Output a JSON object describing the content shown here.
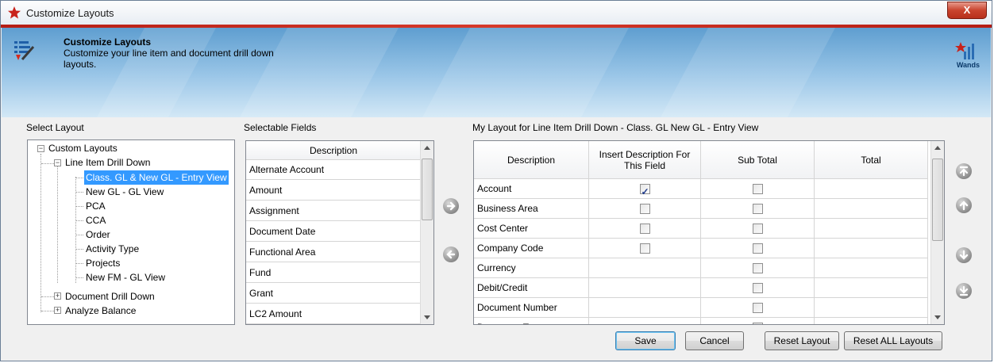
{
  "window": {
    "title": "Customize Layouts",
    "close_label": "X"
  },
  "banner": {
    "title": "Customize Layouts",
    "description": "Customize your line item and document drill down layouts.",
    "brand": "Wands"
  },
  "select_layout": {
    "label": "Select Layout",
    "tree": {
      "root": "Custom Layouts",
      "line_item": "Line Item Drill Down",
      "children": [
        "Class. GL & New GL - Entry View",
        "New GL - GL View",
        "PCA",
        "CCA",
        "Order",
        "Activity Type",
        "Projects",
        "New FM - GL View"
      ],
      "document": "Document Drill Down",
      "analyze": "Analyze Balance",
      "selected_index": 0
    }
  },
  "selectable_fields": {
    "label": "Selectable Fields",
    "header": "Description",
    "rows": [
      "Alternate Account",
      "Amount",
      "Assignment",
      "Document Date",
      "Functional Area",
      "Fund",
      "Grant",
      "LC2 Amount"
    ]
  },
  "my_layout": {
    "label": "My Layout  for Line Item Drill Down - Class. GL  New GL - Entry View",
    "columns": [
      "Description",
      "Insert Description For This Field",
      "Sub Total",
      "Total"
    ],
    "rows": [
      {
        "description": "Account",
        "insert_desc": true,
        "insert_desc_visible": true,
        "sub_total": false
      },
      {
        "description": "Business Area",
        "insert_desc": false,
        "insert_desc_visible": true,
        "sub_total": false
      },
      {
        "description": "Cost Center",
        "insert_desc": false,
        "insert_desc_visible": true,
        "sub_total": false
      },
      {
        "description": "Company Code",
        "insert_desc": false,
        "insert_desc_visible": true,
        "sub_total": false
      },
      {
        "description": "Currency",
        "insert_desc": false,
        "insert_desc_visible": false,
        "sub_total": false
      },
      {
        "description": "Debit/Credit",
        "insert_desc": false,
        "insert_desc_visible": false,
        "sub_total": false
      },
      {
        "description": "Document Number",
        "insert_desc": false,
        "insert_desc_visible": false,
        "sub_total": false
      },
      {
        "description": "Document Type",
        "insert_desc": false,
        "insert_desc_visible": false,
        "sub_total": true
      }
    ]
  },
  "buttons": {
    "save": "Save",
    "cancel": "Cancel",
    "reset_layout": "Reset Layout",
    "reset_all": "Reset ALL Layouts"
  },
  "colors": {
    "selection": "#3399ff",
    "title_accent": "#c8221b",
    "banner": "#6fa9d8"
  }
}
